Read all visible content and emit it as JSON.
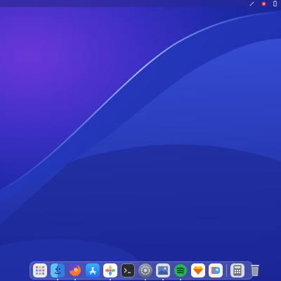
{
  "menubar": {
    "status_icons": [
      "wifi-icon",
      "notification-icon",
      "battery-icon"
    ]
  },
  "dock": {
    "apps": [
      {
        "name": "launchpad",
        "icon": "grid-icon",
        "running": false
      },
      {
        "name": "finder",
        "icon": "finder-icon",
        "running": true
      },
      {
        "name": "firefox",
        "icon": "firefox-icon",
        "running": true
      },
      {
        "name": "app-store",
        "icon": "app-store-icon",
        "running": false
      },
      {
        "name": "photos",
        "icon": "photos-icon",
        "running": true
      },
      {
        "name": "terminal",
        "icon": "terminal-icon",
        "running": false
      },
      {
        "name": "system-preferences",
        "icon": "gear-icon",
        "running": true
      },
      {
        "name": "image-viewer",
        "icon": "image-icon",
        "running": true
      },
      {
        "name": "spotify",
        "icon": "spotify-icon",
        "running": true
      },
      {
        "name": "sketch",
        "icon": "sketch-icon",
        "running": false
      },
      {
        "name": "preview",
        "icon": "preview-icon",
        "running": false
      }
    ],
    "trailing": [
      {
        "name": "calculator",
        "icon": "calculator-icon",
        "running": false
      },
      {
        "name": "trash",
        "icon": "trash-icon",
        "running": false
      }
    ]
  },
  "colors": {
    "accent": "#3b2fc4",
    "deep": "#141f8a",
    "highlight": "#7f90ff"
  }
}
